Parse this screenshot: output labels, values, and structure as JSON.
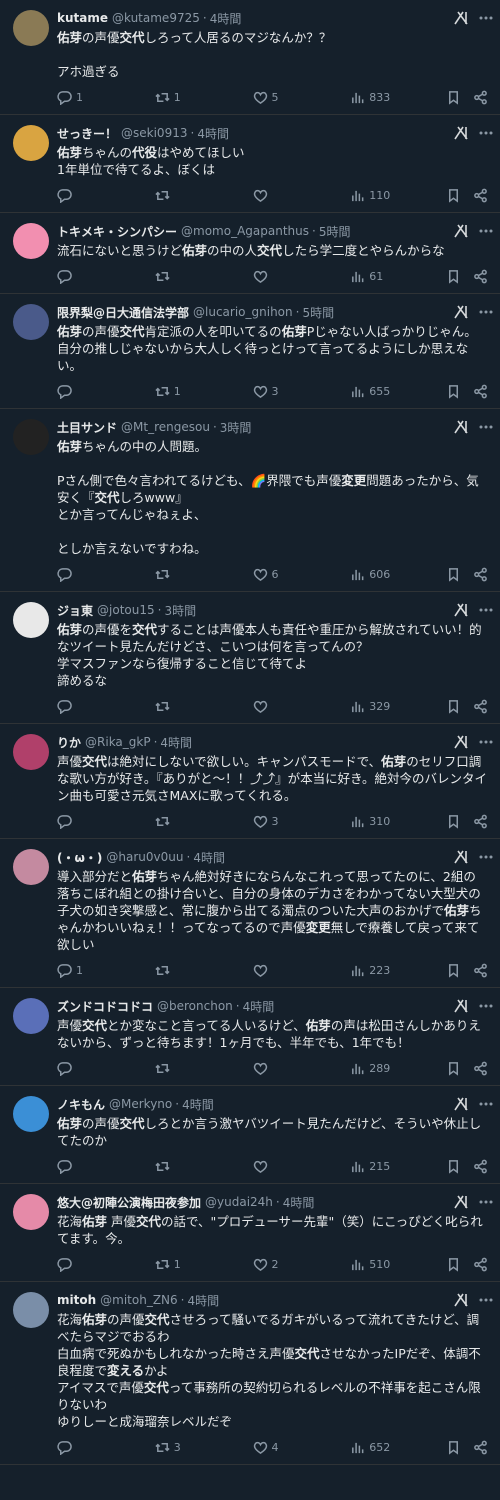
{
  "tweets": [
    {
      "name": "kutame",
      "handle": "@kutame9725",
      "time": "4時間",
      "avatar": "#8a7a55",
      "text": "<b>佑芽</b>の声優<b>交代</b>しろって人居るのマジなんか？？\n\nアホ過ぎる",
      "replies": "1",
      "retweets": "1",
      "likes": "5",
      "views": "833"
    },
    {
      "name": "せっきー！",
      "handle": "@seki0913",
      "time": "4時間",
      "avatar": "#d9a441",
      "text": "<b>佑芽</b>ちゃんの<b>代役</b>はやめてほしい\n1年単位で待てるよ、ぼくは",
      "replies": "",
      "retweets": "",
      "likes": "",
      "views": "110"
    },
    {
      "name": "トキメキ・シンパシー",
      "handle": "@momo_Agapanthus",
      "time": "5時間",
      "avatar": "#f28fb0",
      "text": "流石にないと思うけど<b>佑芽</b>の中の人<b>交代</b>したら学二度とやらんからな",
      "replies": "",
      "retweets": "",
      "likes": "",
      "views": "61"
    },
    {
      "name": "限界梨@日大通信法学部",
      "handle": "@lucario_gnihon",
      "time": "5時間",
      "avatar": "#4a5a8a",
      "text": "<b>佑芽</b>の声優<b>交代</b>肯定派の人を叩いてるの<b>佑芽</b>Pじゃない人ばっかりじゃん。自分の推しじゃないから大人しく待っとけって言ってるようにしか思えない。",
      "replies": "",
      "retweets": "1",
      "likes": "3",
      "views": "655"
    },
    {
      "name": "土目サンド",
      "handle": "@Mt_rengesou",
      "time": "3時間",
      "avatar": "#222222",
      "text": "<b>佑芽</b>ちゃんの中の人問題。\n\nPさん側で色々言われてるけども、🌈界隈でも声優<b>変更</b>問題あったから、気安く『<b>交代</b>しろwww』\nとか言ってんじゃねぇよ、\n\nとしか言えないですわね。",
      "replies": "",
      "retweets": "",
      "likes": "6",
      "views": "606"
    },
    {
      "name": "ジョ東",
      "handle": "@jotou15",
      "time": "3時間",
      "avatar": "#e8e8e8",
      "text": "<b>佑芽</b>の声優を<b>交代</b>することは声優本人も責任や重圧から解放されていい！的なツイート見たんだけどさ、こいつは何を言ってんの？\n学マスファンなら復帰すること信じて待てよ\n諦めるな",
      "replies": "",
      "retweets": "",
      "likes": "",
      "views": "329"
    },
    {
      "name": "りか",
      "handle": "@Rika_gkP",
      "time": "4時間",
      "avatar": "#b0406a",
      "text": "声優<b>交代</b>は絶対にしないで欲しい。キャンパスモードで、<b>佑芽</b>のセリフ口調な歌い方が好き。『ありがと〜！！⤴︎⤴︎』が本当に好き。絶対今のバレンタイン曲も可愛さ元気さMAXに歌ってくれる。",
      "replies": "",
      "retweets": "",
      "likes": "3",
      "views": "310"
    },
    {
      "name": "(・ω・)",
      "handle": "@haru0v0uu",
      "time": "4時間",
      "avatar": "#c48aa0",
      "text": "導入部分だと<b>佑芽</b>ちゃん絶対好きにならんなこれって思ってたのに、2組の落ちこぼれ組との掛け合いと、自分の身体のデカさをわかってない大型犬の子犬の如き突撃感と、常に腹から出てる濁点のついた大声のおかげで<b>佑芽</b>ちゃんかわいいねぇ！！ってなってるので声優<b>変更</b>無しで療養して戻って来て欲しい",
      "replies": "1",
      "retweets": "",
      "likes": "",
      "views": "223"
    },
    {
      "name": "ズンドコドコドコ",
      "handle": "@beronchon",
      "time": "4時間",
      "avatar": "#5a6fb8",
      "text": "声優<b>交代</b>とか変なこと言ってる人いるけど、<b>佑芽</b>の声は松田さんしかありえないから、ずっと待ちます！1ヶ月でも、半年でも、1年でも！",
      "replies": "",
      "retweets": "",
      "likes": "",
      "views": "289"
    },
    {
      "name": "ノキもん",
      "handle": "@Merkyno",
      "time": "4時間",
      "avatar": "#3b8fd6",
      "text": "<b>佑芽</b>の声優<b>交代</b>しろとか言う激ヤバツイート見たんだけど、そういや休止してたのか",
      "replies": "",
      "retweets": "",
      "likes": "",
      "views": "215"
    },
    {
      "name": "悠大@初陣公演梅田夜参加",
      "handle": "@yudai24h",
      "time": "4時間",
      "avatar": "#e58aa8",
      "text": "花海<b>佑芽</b> 声優<b>交代</b>の話で、\"プロデューサー先輩\"（笑）にこっぴどく叱られてます。今。",
      "replies": "",
      "retweets": "1",
      "likes": "2",
      "views": "510"
    },
    {
      "name": "mitoh",
      "handle": "@mitoh_ZN6",
      "time": "4時間",
      "avatar": "#7a8ea8",
      "text": "花海<b>佑芽</b>の声優<b>交代</b>させろって騒いでるガキがいるって流れてきたけど、調べたらマジでおるわ\n白血病で死ぬかもしれなかった時さえ声優<b>交代</b>させなかったIPだぞ、体調不良程度で<b>変える</b>かよ\nアイマスで声優<b>交代</b>って事務所の契約切られるレベルの不祥事を起こさん限りないわ\nゆりしーと成海瑠奈レベルだぞ",
      "replies": "",
      "retweets": "3",
      "likes": "4",
      "views": "652"
    }
  ]
}
